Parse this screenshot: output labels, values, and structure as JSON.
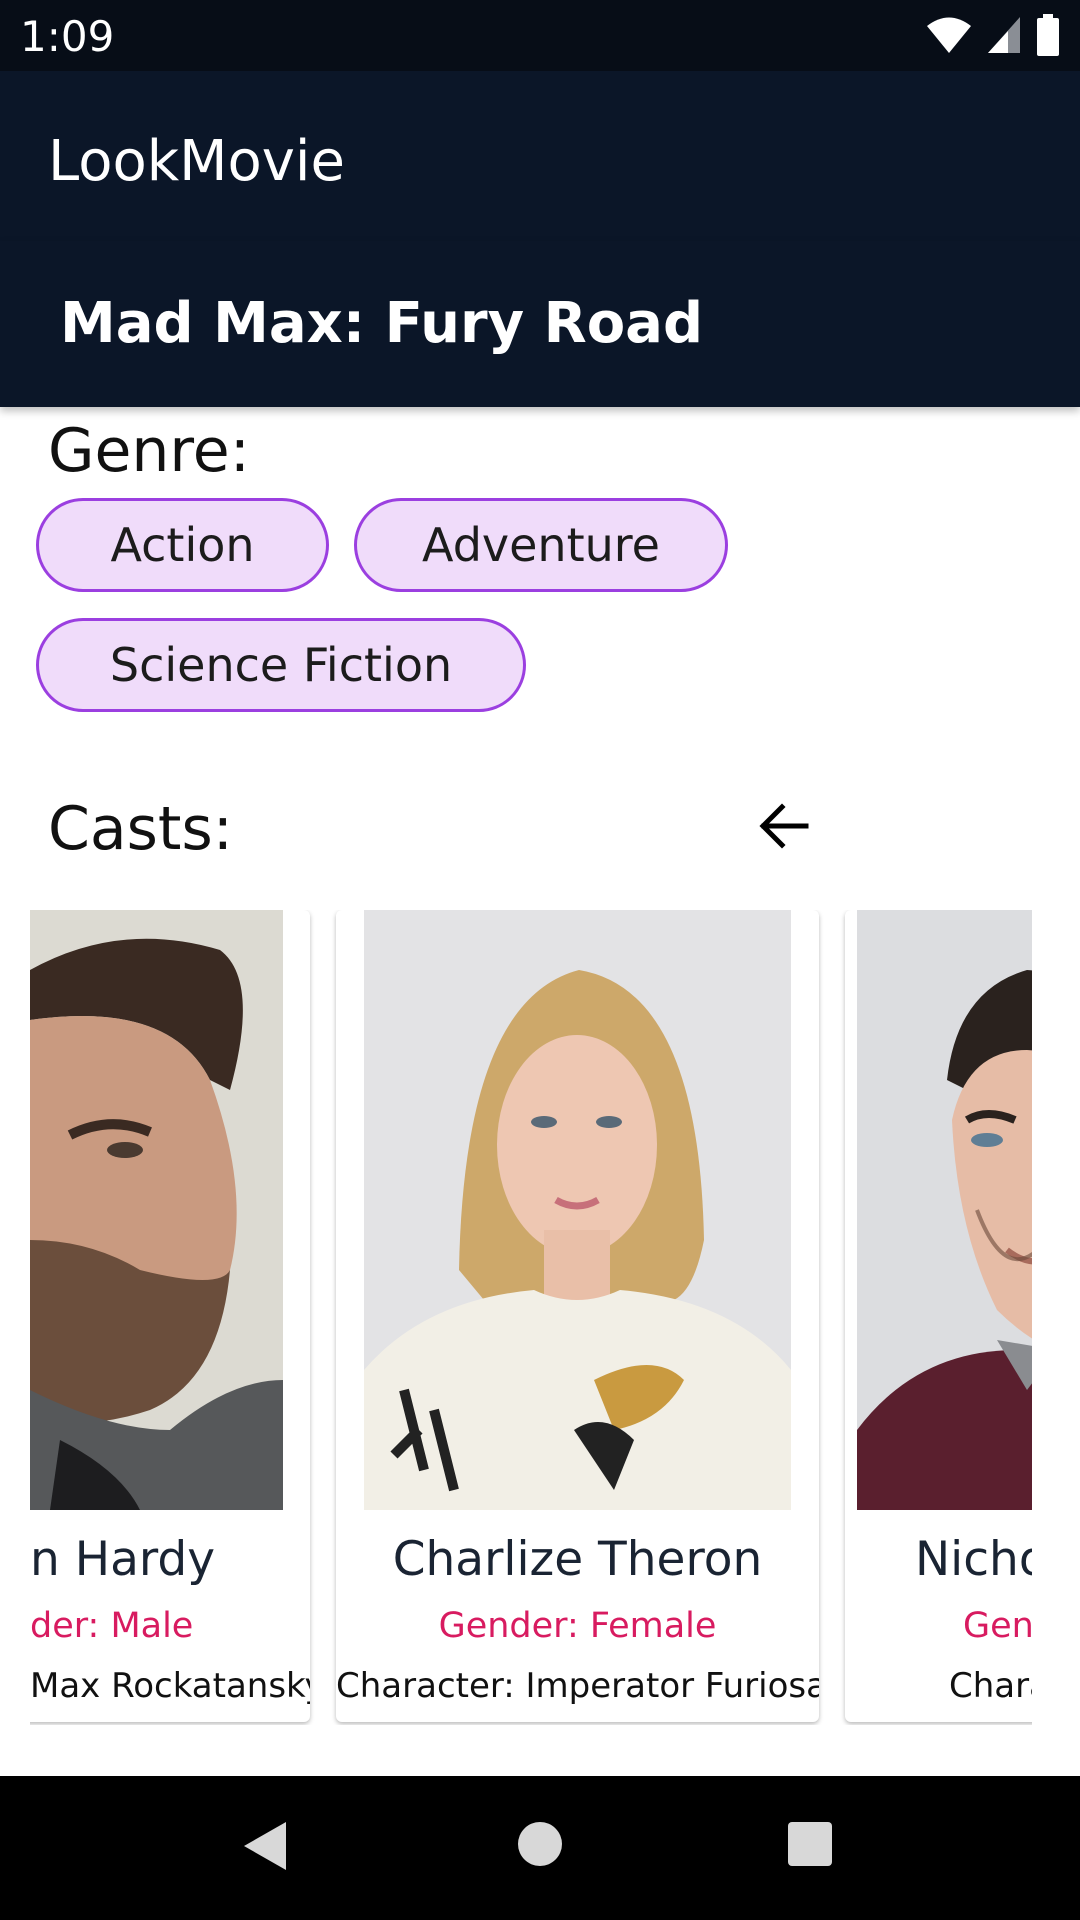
{
  "status_bar": {
    "time": "1:09"
  },
  "app_bar": {
    "title": "LookMovie"
  },
  "movie": {
    "title": "Mad Max: Fury Road"
  },
  "genre": {
    "label": "Genre:",
    "chips": [
      "Action",
      "Adventure",
      "Science Fiction"
    ]
  },
  "casts": {
    "label": "Casts:",
    "items": [
      {
        "name": "n Hardy",
        "gender": "der: Male",
        "character": "Max Rockatansky"
      },
      {
        "name": "Charlize Theron",
        "gender": "Gender: Female",
        "character": "Character: Imperator Furiosa"
      },
      {
        "name": "Nicho",
        "gender": "Gen",
        "character": "Chara"
      }
    ]
  },
  "colors": {
    "app_bar": "#0b1628",
    "chip_fill": "#f0dcfa",
    "chip_border": "#9b3fe0",
    "gender_text": "#d81b60"
  }
}
